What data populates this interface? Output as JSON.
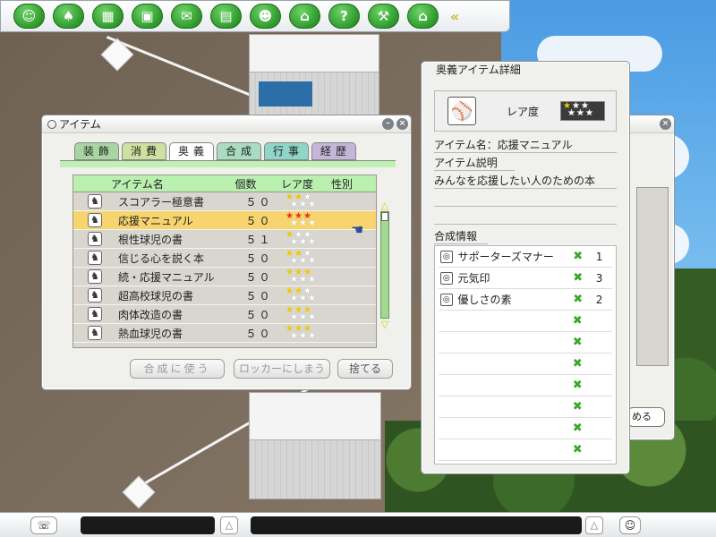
{
  "toolbar": {
    "buttons": [
      {
        "icon": "profile-icon",
        "glyph": "☺"
      },
      {
        "icon": "player-icon",
        "glyph": "♠"
      },
      {
        "icon": "film-icon",
        "glyph": "▦"
      },
      {
        "icon": "gift-icon",
        "glyph": "▣"
      },
      {
        "icon": "message-icon",
        "glyph": "✉"
      },
      {
        "icon": "notebook-icon",
        "glyph": "▤"
      },
      {
        "icon": "friends-icon",
        "glyph": "☻"
      },
      {
        "icon": "building-icon",
        "glyph": "⌂"
      },
      {
        "icon": "help-icon",
        "glyph": "?"
      },
      {
        "icon": "bat-icon",
        "glyph": "⚒"
      },
      {
        "icon": "home-icon",
        "glyph": "⌂"
      }
    ],
    "collapse_glyph": "«"
  },
  "item_window": {
    "title": "アイテム",
    "minimize_glyph": "–",
    "close_glyph": "×",
    "tabs": [
      "装飾",
      "消費",
      "奥義",
      "合成",
      "行事",
      "経歴"
    ],
    "active_tab": "奥義",
    "columns": {
      "name": "アイテム名",
      "count": "個数",
      "rarity": "レア度",
      "gender": "性別"
    },
    "items": [
      {
        "name": "スコアラー極意書",
        "count": "５０",
        "rarity": 2,
        "selected": false
      },
      {
        "name": "応援マニュアル",
        "count": "５０",
        "rarity": 3,
        "selected": true
      },
      {
        "name": "根性球児の書",
        "count": "５１",
        "rarity": 1,
        "selected": false
      },
      {
        "name": "信じる心を説く本",
        "count": "５０",
        "rarity": 2,
        "selected": false
      },
      {
        "name": "続・応援マニュアル",
        "count": "５０",
        "rarity": 3,
        "selected": false
      },
      {
        "name": "超高校球児の書",
        "count": "５０",
        "rarity": 2,
        "selected": false
      },
      {
        "name": "肉体改造の書",
        "count": "５０",
        "rarity": 3,
        "selected": false
      },
      {
        "name": "熱血球児の書",
        "count": "５０",
        "rarity": 3,
        "selected": false
      }
    ],
    "scroll_up": "△",
    "scroll_down": "▽",
    "buttons": {
      "use_compose": "合成に使う",
      "store_locker": "ロッカーにしまう",
      "discard": "捨てる"
    }
  },
  "detail_window": {
    "title": "奥義アイテム詳細",
    "rarity_label": "レア度",
    "rarity": 1,
    "item_name_line": "アイテム名：応援マニュアル",
    "description_label": "アイテム説明",
    "description": "みんなを応援したい人のための本",
    "compose_label": "合成情報",
    "compose_items": [
      {
        "name": "サポーターズマナー",
        "mark": "✖",
        "qty": "1"
      },
      {
        "name": "元気印",
        "mark": "✖",
        "qty": "3"
      },
      {
        "name": "優しさの素",
        "mark": "✖",
        "qty": "2"
      },
      {
        "name": "",
        "mark": "✖",
        "qty": ""
      },
      {
        "name": "",
        "mark": "✖",
        "qty": ""
      },
      {
        "name": "",
        "mark": "✖",
        "qty": ""
      },
      {
        "name": "",
        "mark": "✖",
        "qty": ""
      },
      {
        "name": "",
        "mark": "✖",
        "qty": ""
      },
      {
        "name": "",
        "mark": "✖",
        "qty": ""
      },
      {
        "name": "",
        "mark": "✖",
        "qty": ""
      }
    ]
  },
  "back_window": {
    "close_glyph": "×",
    "button_partial": "める"
  },
  "bottombar": {
    "chat_glyph": "☏",
    "up_glyph": "△",
    "smile_glyph": "☺"
  },
  "colors": {
    "toolbar_button": "#2e9a2b",
    "selected_row": "#f8d46e",
    "star_on": "#f0c800",
    "header_green": "#b9f0b0",
    "compose_mark": "#39a829"
  }
}
